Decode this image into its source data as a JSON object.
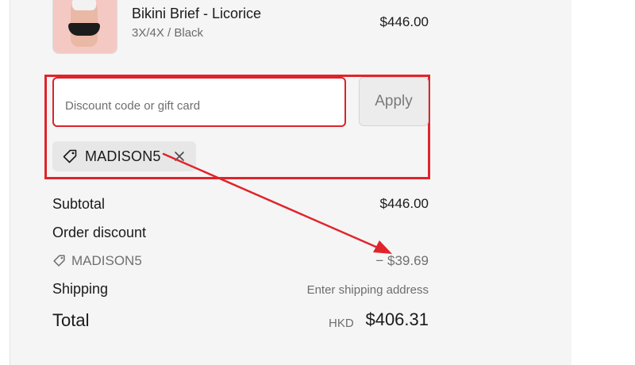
{
  "product": {
    "name": "Bikini Brief - Licorice",
    "variant": "3X/4X / Black",
    "price": "$446.00",
    "thumbnail_icon": "product-photo"
  },
  "discount": {
    "placeholder": "Discount code or gift card",
    "value": "",
    "apply_label": "Apply",
    "applied_code": "MADISON5",
    "tag_icon": "tag-icon",
    "remove_icon": "close-icon"
  },
  "summary": {
    "subtotal_label": "Subtotal",
    "subtotal_value": "$446.00",
    "order_discount_label": "Order discount",
    "discount_code": "MADISON5",
    "discount_value": "− $39.69",
    "shipping_label": "Shipping",
    "shipping_value": "Enter shipping address",
    "total_label": "Total",
    "total_currency": "HKD",
    "total_value": "$406.31"
  },
  "colors": {
    "highlight": "#e0242b",
    "panel_bg": "#f5f5f5"
  }
}
